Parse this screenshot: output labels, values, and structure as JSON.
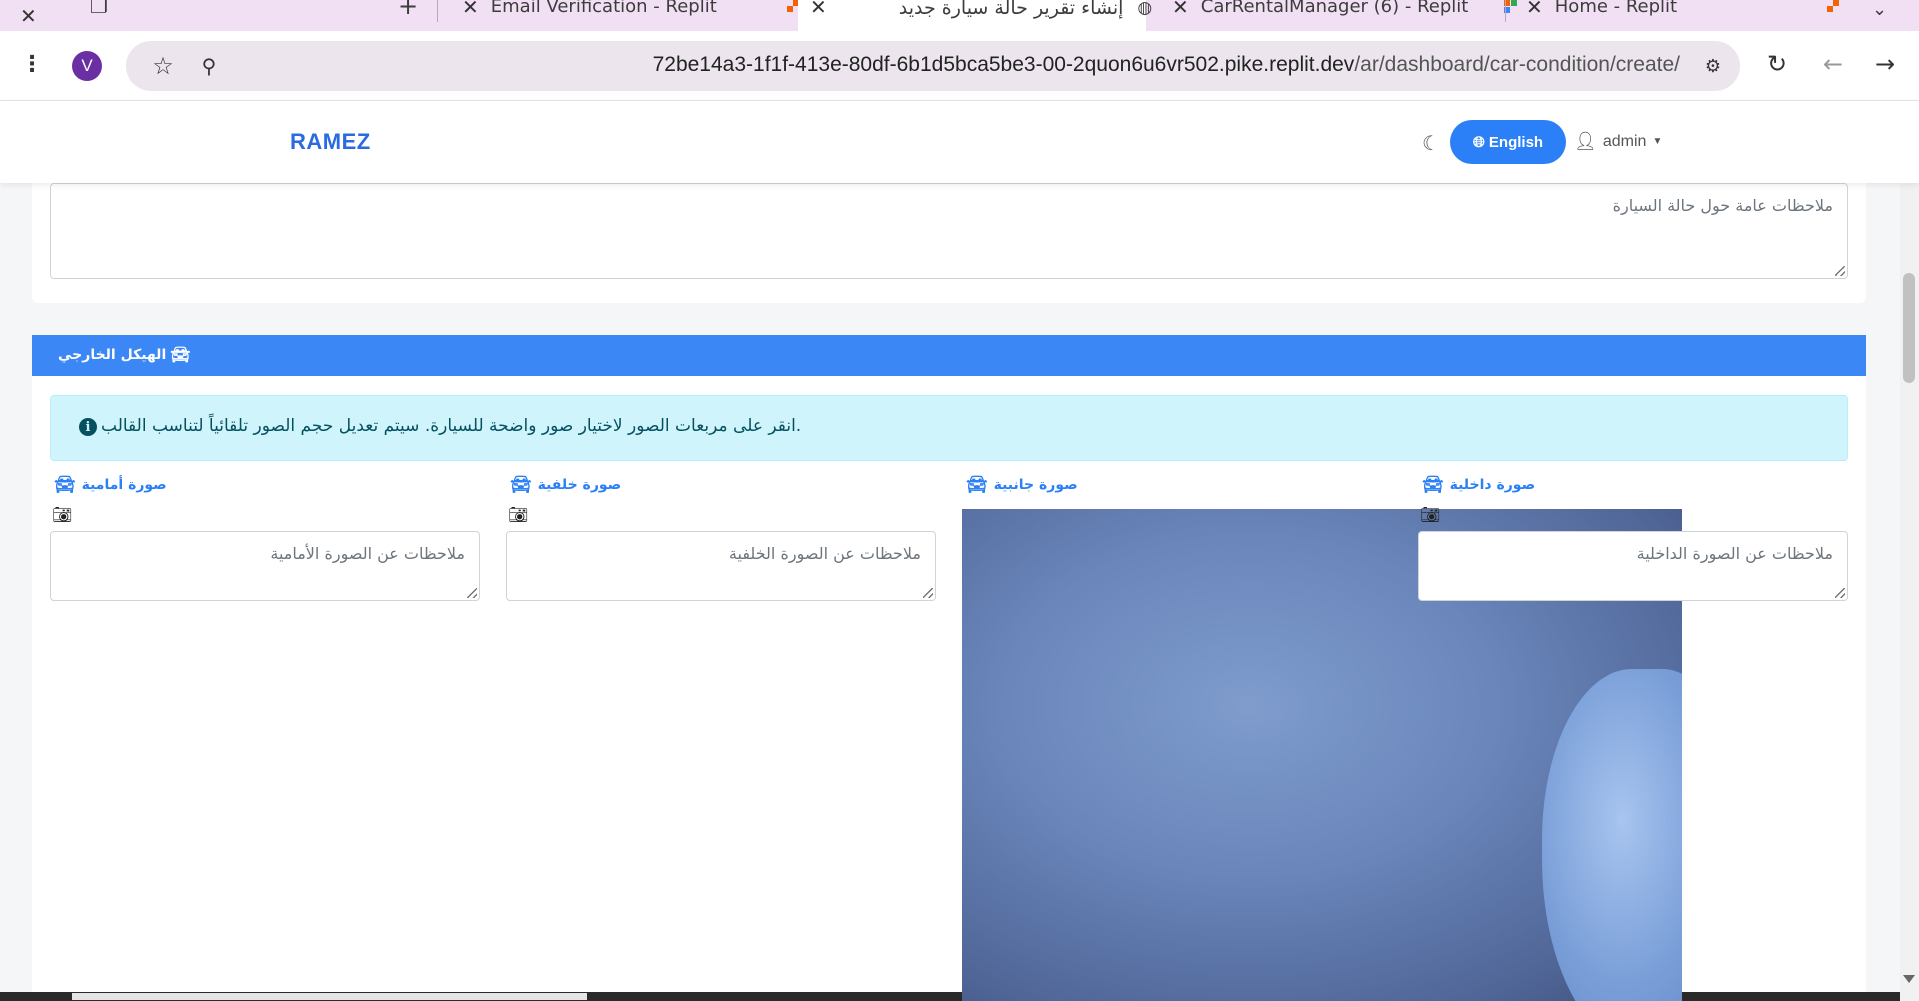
{
  "browser": {
    "tabs": [
      {
        "title": "Email Verification - Replit"
      },
      {
        "title": "إنشاء تقرير حالة سيارة جديد"
      },
      {
        "title": "CarRentalManager (6) - Replit"
      },
      {
        "title": "Home - Replit"
      }
    ],
    "profile_initial": "V",
    "url_host": "72be14a3-1f1f-413e-80df-6b1d5bca5be3-00-2quon6u6vr502.pike.replit.dev",
    "url_path": "/ar/dashboard/car-condition/create/"
  },
  "navbar": {
    "brand": "RAMEZ",
    "language_button": "English",
    "user_label": "admin"
  },
  "general_notes": {
    "placeholder": "ملاحظات عامة حول حالة السيارة"
  },
  "exterior_section": {
    "title": "الهيكل الخارجي",
    "info_alert": ".انقر على مربعات الصور لاختيار صور واضحة للسيارة. سيتم تعديل حجم الصور تلقائياً لتناسب القالب",
    "photos": [
      {
        "title": "صورة أمامية",
        "placeholder": "ملاحظات عن الصورة الأمامية"
      },
      {
        "title": "صورة خلفية",
        "placeholder": "ملاحظات عن الصورة الخلفية"
      },
      {
        "title": "صورة جانبية",
        "placeholder": ""
      },
      {
        "title": "صورة داخلية",
        "placeholder": "ملاحظات عن الصورة الداخلية"
      }
    ]
  },
  "colors": {
    "primary": "#3b87f6",
    "brand": "#2b6be0",
    "alert_bg": "#cff4fc",
    "tabstrip": "#f1dff3"
  }
}
